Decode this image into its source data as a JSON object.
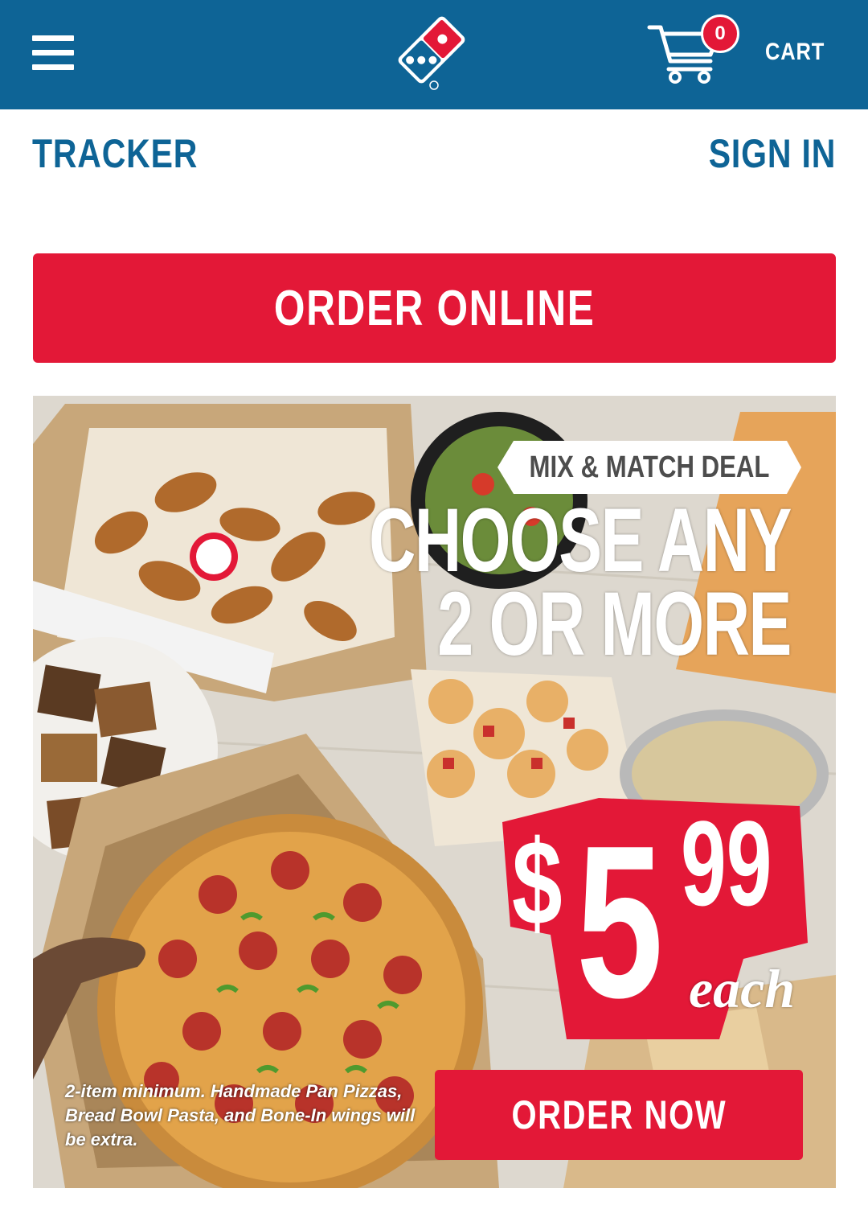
{
  "header": {
    "menu_icon": "hamburger-menu-icon",
    "logo_icon": "dominos-logo",
    "cart_icon": "shopping-cart-icon",
    "cart_count": "0",
    "cart_label": "CART"
  },
  "subnav": {
    "tracker_label": "TRACKER",
    "signin_label": "SIGN IN"
  },
  "order_online_label": "ORDER ONLINE",
  "promo": {
    "deal_tag": "MIX & MATCH DEAL",
    "headline_line1": "CHOOSE ANY",
    "headline_line2": "2 OR MORE",
    "price_dollar": "$",
    "price_main": "5",
    "price_cents": "99",
    "price_each": "each",
    "disclaimer": "2-item minimum. Handmade Pan Pizzas, Bread Bowl Pasta, and Bone-In wings will be extra.",
    "order_now_label": "ORDER NOW"
  },
  "colors": {
    "brand_blue": "#0e6496",
    "brand_red": "#e31837"
  }
}
